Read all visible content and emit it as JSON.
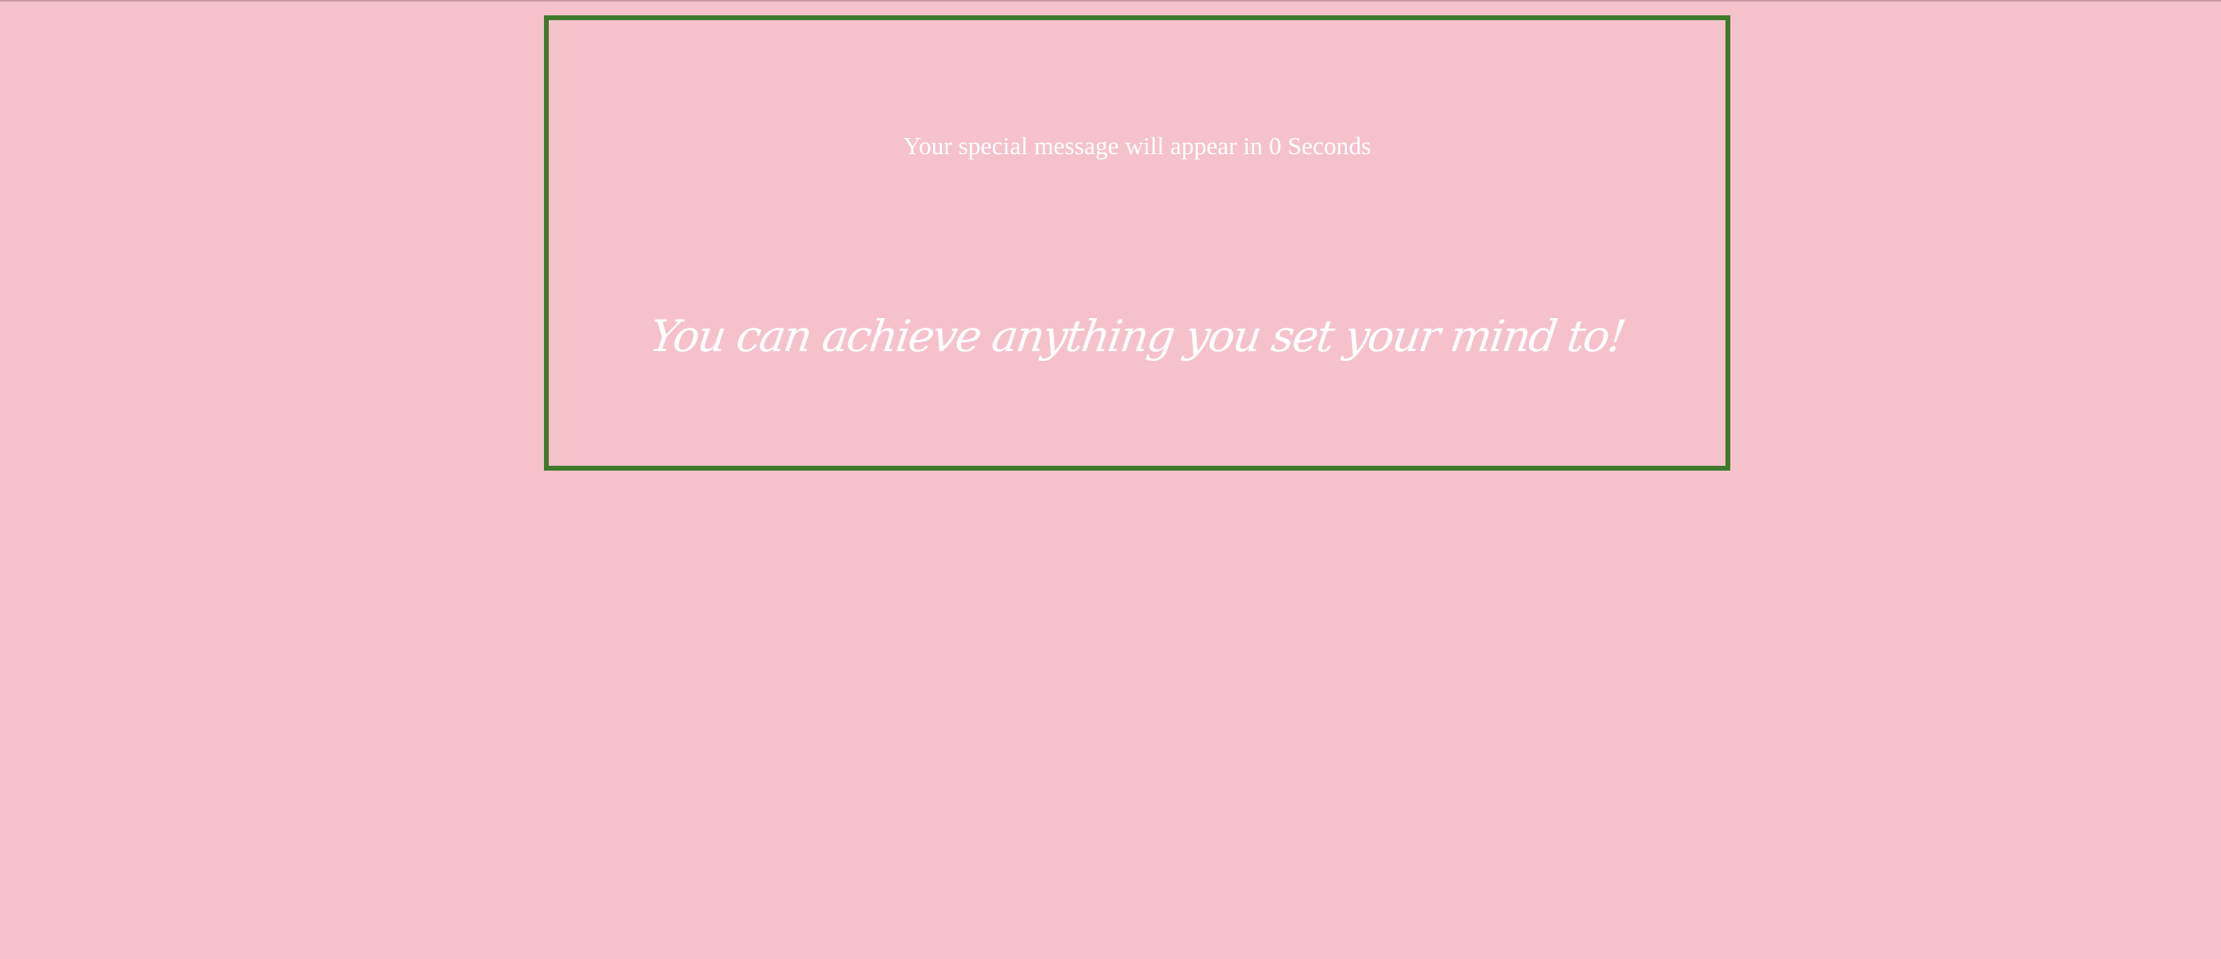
{
  "colors": {
    "background": "#f5c2cc",
    "border": "#3f7a2c",
    "text": "#ffffff"
  },
  "countdown": {
    "text": "Your special message will appear in 0 Seconds"
  },
  "message": {
    "text": "You can achieve anything you set your mind to!"
  }
}
